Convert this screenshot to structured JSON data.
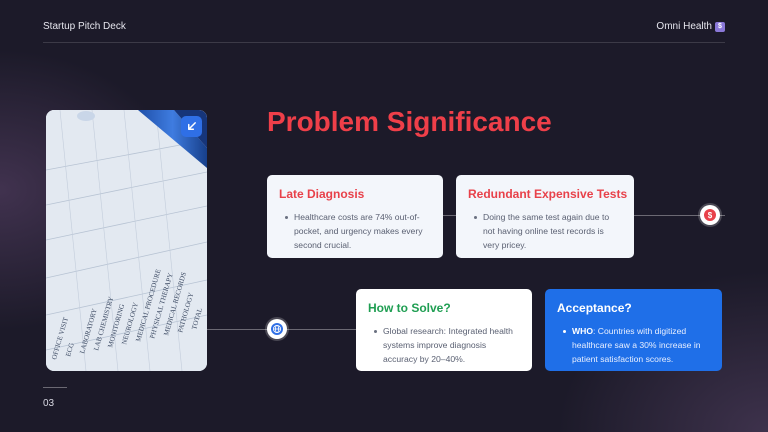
{
  "header": {
    "title": "Startup Pitch Deck",
    "brand": "Omni Health",
    "brand_badge": "$"
  },
  "slide": {
    "title": "Problem Significance",
    "page_number": "03"
  },
  "photo": {
    "alt": "medical form photo",
    "form_lines": [
      "OFFICE VISIT",
      "ECG",
      "LABORATORY",
      "LAB CHEMISTRY",
      "MONITORING",
      "NEUROLOGY",
      "MEDICAL PROCEDURE",
      "PHYSICAL THERAPY",
      "MEDICAL RECORDS",
      "PATHOLOGY",
      "TOTAL"
    ]
  },
  "icons": {
    "expand": "expand-arrow-icon",
    "dollar": "dollar-icon",
    "globe": "globe-icon"
  },
  "cards": [
    {
      "title": "Late Diagnosis",
      "text": "Healthcare costs are 74% out-of-pocket, and urgency makes every second crucial."
    },
    {
      "title": "Redundant Expensive Tests",
      "text": "Doing the same test again due to not having online test records is very pricey."
    },
    {
      "title": "How to Solve?",
      "text": "Global research: Integrated health systems improve diagnosis accuracy by 20–40%."
    },
    {
      "title": "Acceptance?",
      "strong": "WHO",
      "text": ": Countries with digitized healthcare saw a 30% increase in patient satisfaction scores."
    }
  ],
  "colors": {
    "accent_red": "#ef3f49",
    "accent_green": "#1f9e52",
    "accent_blue": "#1f6fe8",
    "background": "#1c1a29"
  }
}
